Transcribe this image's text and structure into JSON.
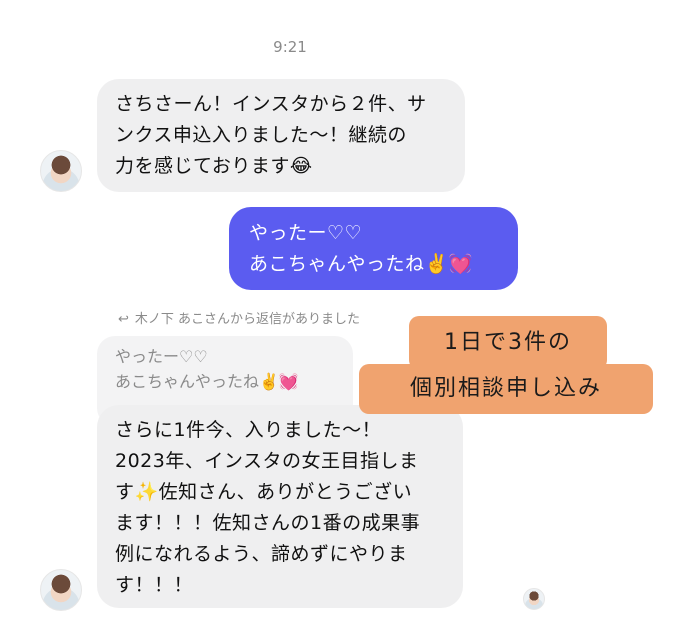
{
  "time": "9:21",
  "messages": {
    "m1": {
      "line1": "さちさーん！インスタから２件、サ",
      "line2": "ンクス申込入りました〜！継続の",
      "line3": "力を感じております😂"
    },
    "m2": {
      "line1": "やったー♡♡",
      "line2": "あこちゃんやったね✌️💓"
    },
    "reply_note": "木ノ下 あこさんから返信がありました",
    "quoted": {
      "line1": "やったー♡♡",
      "line2": "あこちゃんやったね✌️💓"
    },
    "m3": {
      "line1": "さらに1件今、入りました〜！",
      "line2": "2023年、インスタの女王目指しま",
      "line3": "す✨佐知さん、ありがとうござい",
      "line4": "ます！！！佐知さんの1番の成果事",
      "line5": "例になれるよう、諦めずにやりま",
      "line6": "す！！！"
    }
  },
  "overlay": {
    "line1": "1日で3件の",
    "line2": "個別相談申し込み"
  },
  "colors": {
    "outgoing_bubble": "#5b5cf0",
    "incoming_bubble": "#efeff0",
    "overlay": "#f0a36f"
  }
}
